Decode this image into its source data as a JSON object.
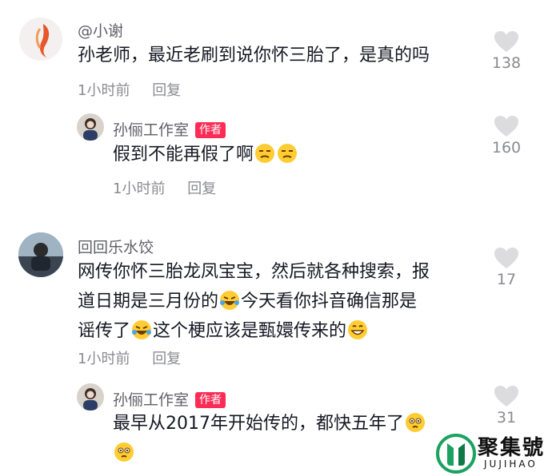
{
  "comments": [
    {
      "username": "@小谢",
      "text": "孙老师，最近老刷到说你怀三胎了，是真的吗",
      "time": "1小时前",
      "reply_label": "回复",
      "likes": "138",
      "reply": {
        "username": "孙俪工作室",
        "badge": "作者",
        "text_parts": [
          "假到不能再假了啊"
        ],
        "time": "1小时前",
        "reply_label": "回复",
        "likes": "160"
      }
    },
    {
      "username": "回回乐水饺",
      "text_line1": "网传你怀三胎龙凤宝宝，然后就各种搜索，报",
      "text_line2a": "道日期是三月份的",
      "text_line2b": "今天看你抖音确信那是",
      "text_line3a": "谣传了",
      "text_line3b": "这个梗应该是甄嬛传来的",
      "time": "1小时前",
      "reply_label": "回复",
      "likes": "17",
      "reply": {
        "username": "孙俪工作室",
        "badge": "作者",
        "text": "最早从2017年开始传的，都快五年了",
        "likes": "31"
      }
    }
  ],
  "watermark": {
    "brand_cn": "聚集號",
    "brand_en": "JUJIHAO",
    "color": "#1aa260"
  },
  "icons": {
    "like": "heart-icon",
    "emoji_smirk": "unamused-face-icon",
    "emoji_laugh": "rofl-face-icon",
    "emoji_grin": "grinning-face-icon",
    "emoji_dizzy": "woozy-face-icon"
  }
}
